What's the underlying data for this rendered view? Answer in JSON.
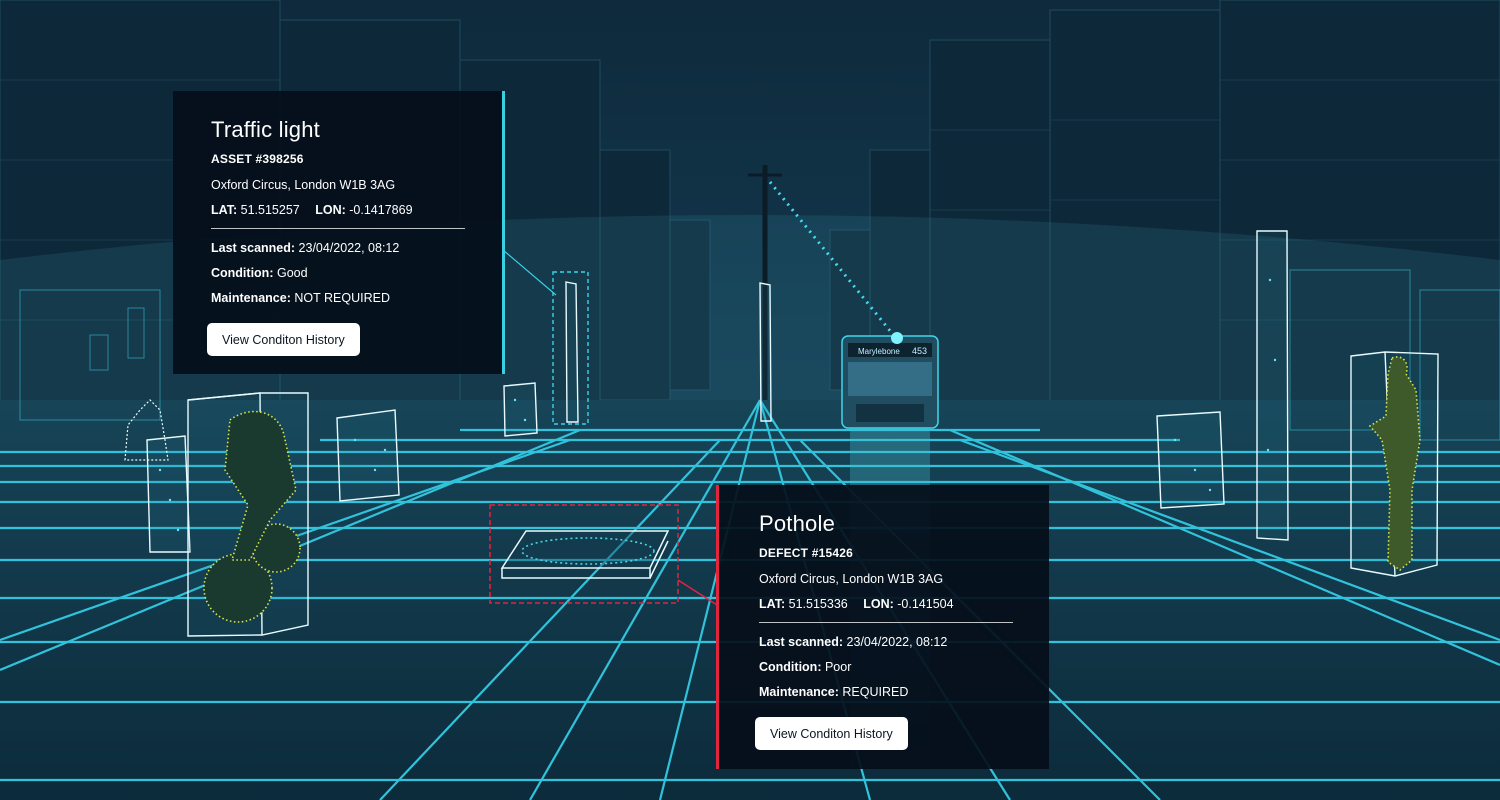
{
  "scene": {
    "bus_sign": "Marylebone",
    "bus_number": "453"
  },
  "cards": {
    "traffic_light": {
      "title": "Traffic light",
      "code": "ASSET #398256",
      "address": "Oxford Circus, London W1B 3AG",
      "lat_label": "LAT:",
      "lat": "51.515257",
      "lon_label": "LON:",
      "lon": "-0.1417869",
      "scanned_label": "Last scanned:",
      "scanned": "23/04/2022, 08:12",
      "condition_label": "Condition:",
      "condition": "Good",
      "maintenance_label": "Maintenance:",
      "maintenance": "NOT REQUIRED",
      "button": "View Conditon History"
    },
    "pothole": {
      "title": "Pothole",
      "code": "DEFECT #15426",
      "address": "Oxford Circus, London W1B 3AG",
      "lat_label": "LAT:",
      "lat": "51.515336",
      "lon_label": "LON:",
      "lon": "-0.141504",
      "scanned_label": "Last scanned:",
      "scanned": "23/04/2022, 08:12",
      "condition_label": "Condition:",
      "condition": "Poor",
      "maintenance_label": "Maintenance:",
      "maintenance": "REQUIRED",
      "button": "View Conditon History"
    }
  },
  "colors": {
    "scan_cyan": "#38d0e3",
    "defect_red": "#e2243f",
    "person_yellow": "#d7e64a",
    "card_bg": "#050e1a"
  }
}
